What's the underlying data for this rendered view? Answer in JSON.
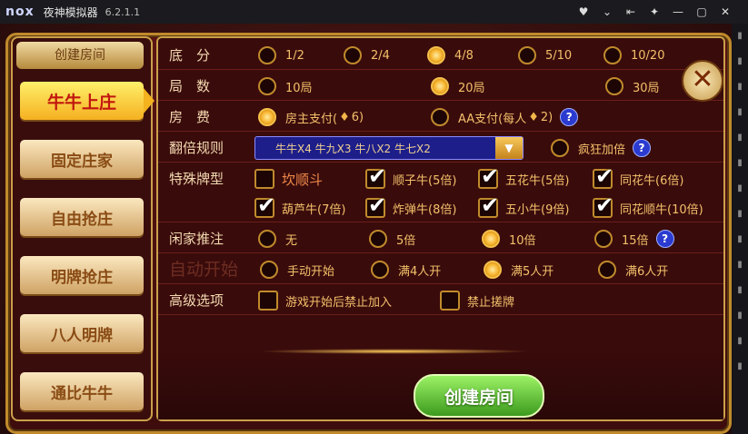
{
  "titlebar": {
    "logo": "nox",
    "title": "夜神模拟器",
    "version": "6.2.1.1"
  },
  "window_controls": [
    "♥",
    "⌄",
    "⇤",
    "✦",
    "—",
    "▢",
    "✕"
  ],
  "left_panel": {
    "header": "创建房间",
    "tabs": [
      {
        "label": "牛牛上庄",
        "active": true
      },
      {
        "label": "固定庄家"
      },
      {
        "label": "自由抢庄"
      },
      {
        "label": "明牌抢庄"
      },
      {
        "label": "八人明牌"
      },
      {
        "label": "通比牛牛"
      }
    ]
  },
  "rows": {
    "base_score": {
      "label": "底　分",
      "options": [
        "1/2",
        "2/4",
        "4/8",
        "5/10",
        "10/20"
      ],
      "selected": 2
    },
    "rounds": {
      "label": "局　数",
      "options": [
        "10局",
        "20局",
        "30局"
      ],
      "selected": 1
    },
    "fee": {
      "label": "房　费",
      "options": [
        {
          "prefix": "房主支付(",
          "gem": "♦",
          "suffix": "6)"
        },
        {
          "prefix": "AA支付(每人",
          "gem": "♦",
          "suffix": "2)"
        }
      ],
      "selected": 0
    },
    "multiplier": {
      "label": "翻倍规则",
      "dropdown_value": "牛牛X4  牛九X3  牛八X2  牛七X2",
      "crazy_label": "疯狂加倍"
    },
    "special": {
      "label": "特殊牌型",
      "options": [
        {
          "label": "坎顺斗",
          "checked": false
        },
        {
          "label": "顺子牛(5倍)",
          "checked": true
        },
        {
          "label": "五花牛(5倍)",
          "checked": true
        },
        {
          "label": "同花牛(6倍)",
          "checked": true
        },
        {
          "label": "葫芦牛(7倍)",
          "checked": true
        },
        {
          "label": "炸弹牛(8倍)",
          "checked": true
        },
        {
          "label": "五小牛(9倍)",
          "checked": true
        },
        {
          "label": "同花顺牛(10倍)",
          "checked": true
        }
      ]
    },
    "push": {
      "label": "闲家推注",
      "options": [
        "无",
        "5倍",
        "10倍",
        "15倍"
      ],
      "selected": 2
    },
    "auto_start": {
      "label": "自动开始",
      "options": [
        "手动开始",
        "满4人开",
        "满5人开",
        "满6人开"
      ],
      "selected": 2
    },
    "advanced": {
      "label": "高级选项",
      "options": [
        {
          "label": "游戏开始后禁止加入",
          "checked": false
        },
        {
          "label": "禁止搓牌",
          "checked": false
        }
      ]
    }
  },
  "create_button": "创建房间",
  "help_symbol": "?",
  "close_symbol": "✕",
  "dropdown_arrow": "▼",
  "colors": {
    "accent": "#f6b22a",
    "create": "#3c9a1e",
    "help": "#2b3bd0"
  }
}
